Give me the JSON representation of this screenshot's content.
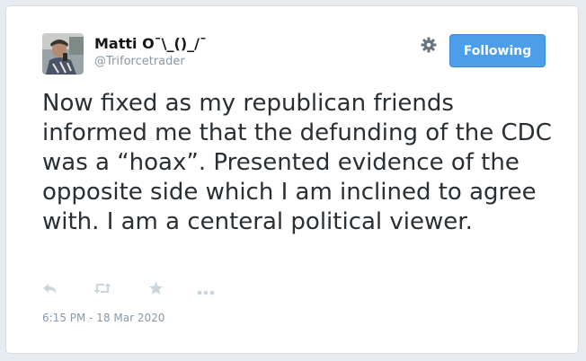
{
  "tweet": {
    "author_name": "Matti O¯\\_()_/¯",
    "author_handle": "@Triforcetrader",
    "follow_label": "Following",
    "text": "Now fixed as my republican friends informed me that the defunding of the CDC was a “hoax”. Presented evidence of the opposite side which I am inclined to agree with. I am a centeral political viewer.",
    "timestamp": "6:15 PM - 18 Mar 2020"
  },
  "icons": {
    "settings": "gear-icon",
    "reply": "reply-icon",
    "retweet": "retweet-icon",
    "like": "star-icon",
    "more": "more-icon"
  },
  "colors": {
    "button_blue": "#4d9ee9",
    "text_dark": "#292f33",
    "text_muted": "#8899a6",
    "icon_gray": "#ccd6dd"
  }
}
